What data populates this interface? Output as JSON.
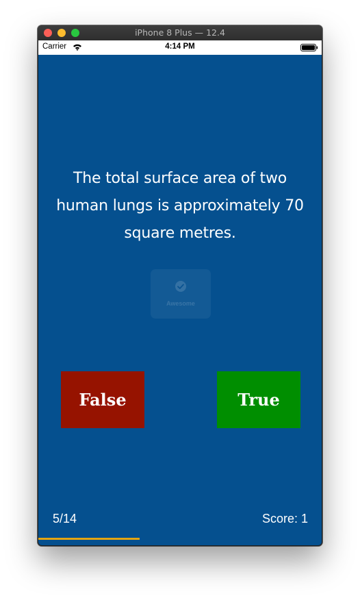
{
  "window": {
    "title": "iPhone 8 Plus — 12.4"
  },
  "status_bar": {
    "carrier": "Carrier",
    "time": "4:14 PM",
    "wifi_icon": "wifi-icon",
    "battery_icon": "battery-icon"
  },
  "quiz": {
    "question": "The total surface area of two human lungs is approximately 70 square metres.",
    "hud_label": "Awesome",
    "hud_icon": "checkmark-icon",
    "false_label": "False",
    "true_label": "True",
    "progress_text": "5/14",
    "score_text": "Score: 1",
    "progress_fraction": 0.357
  },
  "colors": {
    "background": "#05508f",
    "false_button": "#961300",
    "true_button": "#008e00",
    "progress_bar": "#e3a512"
  }
}
